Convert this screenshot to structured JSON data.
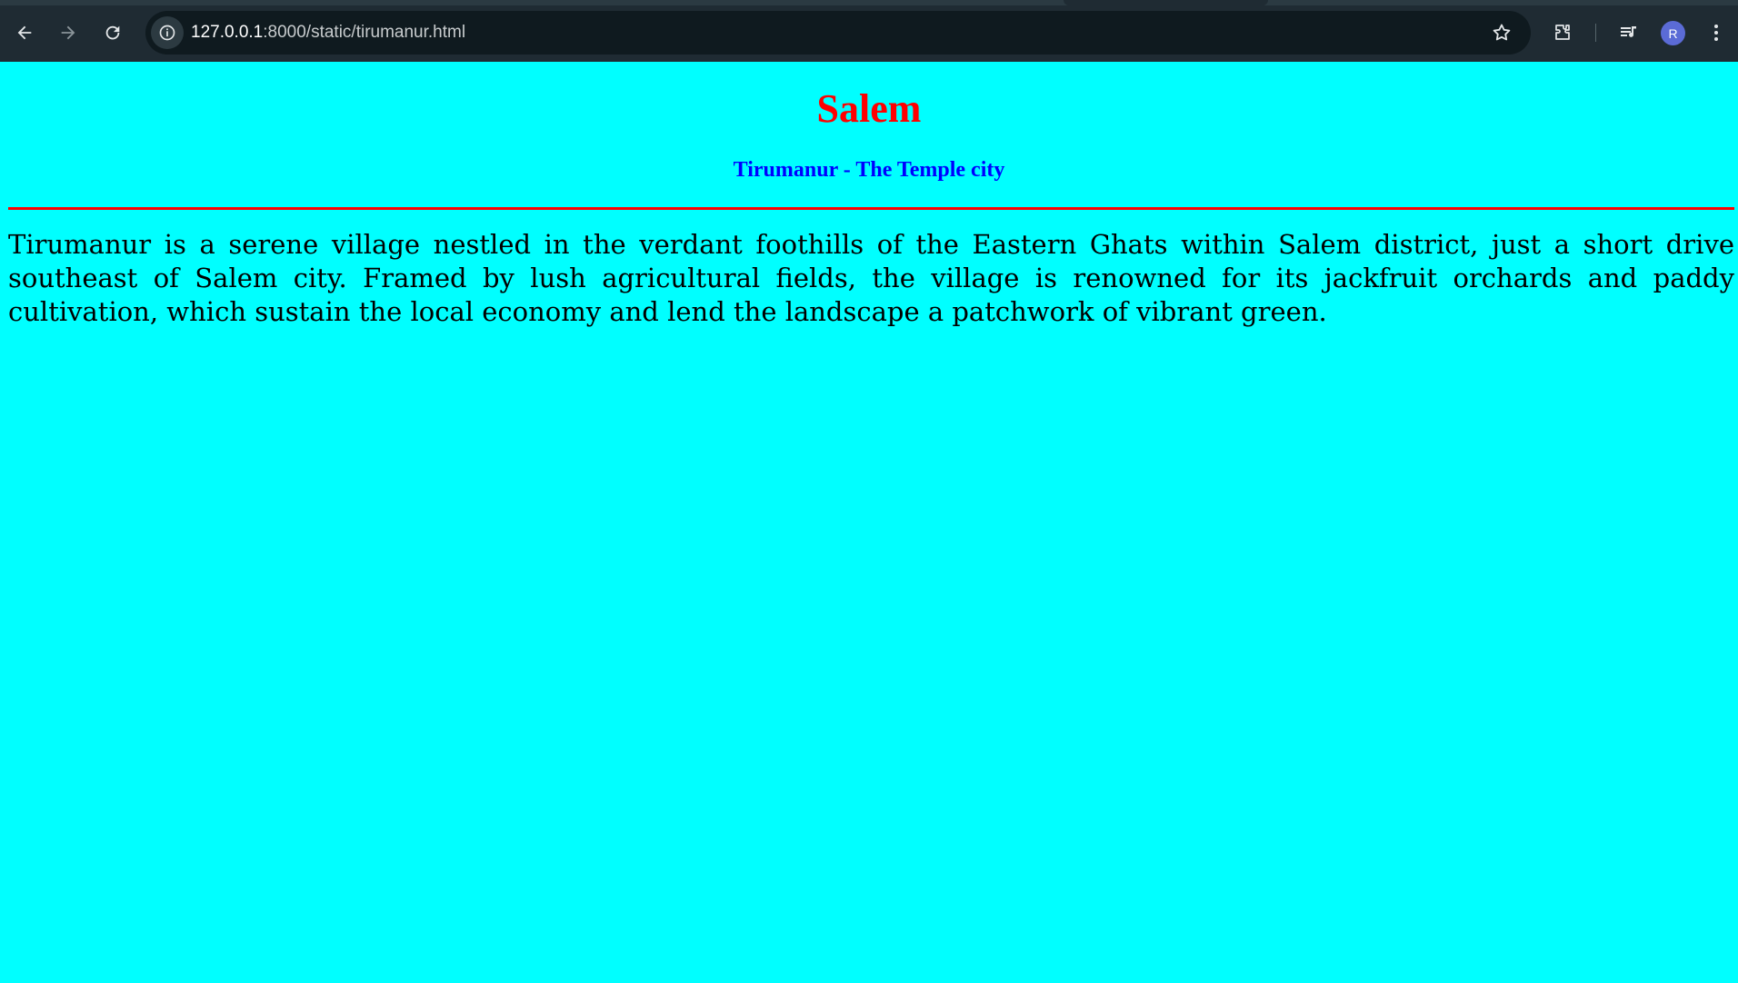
{
  "browser": {
    "url_host": "127.0.0.1",
    "url_path": ":8000/static/tirumanur.html",
    "avatar_letter": "R",
    "icons": [
      "back-arrow-icon",
      "forward-arrow-icon",
      "reload-icon",
      "site-info-icon",
      "bookmark-star-icon",
      "extensions-icon",
      "media-control-icon",
      "more-menu-icon"
    ]
  },
  "page": {
    "title": "Salem",
    "subtitle": "Tirumanur - The Temple city",
    "paragraph": "Tirumanur is a serene village nestled in the verdant foothills of the Eastern Ghats within Salem district, just a short drive southeast of Salem city. Framed by lush agricultural fields, the village is renowned for its jackfruit orchards and paddy cultivation, which sustain the local economy and lend the landscape a patchwork of vibrant green.",
    "colors": {
      "background": "#00ffff",
      "title": "#ff0000",
      "subtitle": "#0000ff",
      "rule": "#ff0000",
      "text": "#000000"
    }
  }
}
